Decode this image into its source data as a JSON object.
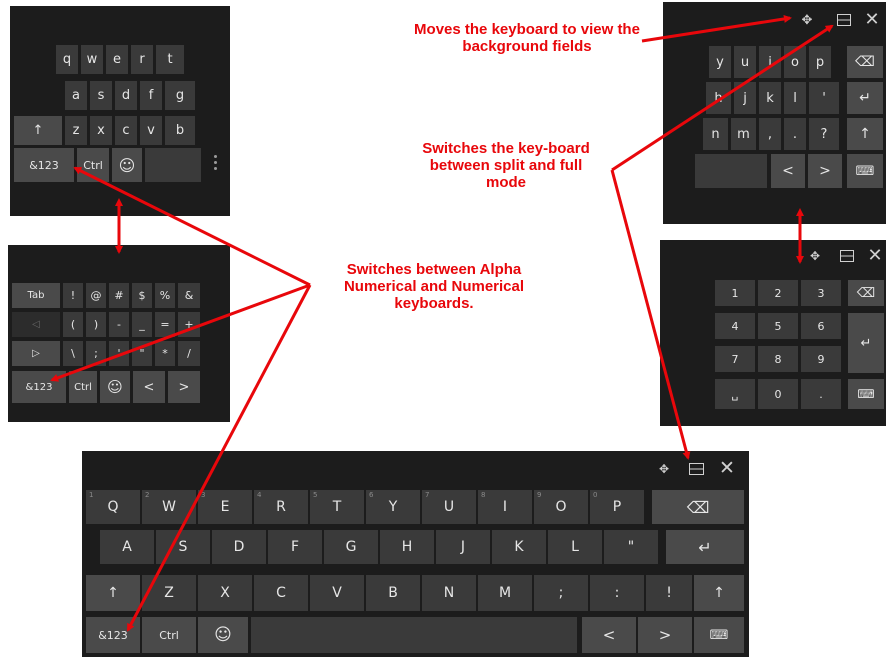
{
  "annotations": {
    "move_keyboard": "Moves the keyboard to view the background fields",
    "split_full": "Switches the key-board between split and full mode",
    "alpha_numeric": "Switches between Alpha Numerical and Numerical keyboards."
  },
  "compact_alpha": {
    "row1": [
      "q",
      "w",
      "e",
      "r",
      "t"
    ],
    "row2": [
      "a",
      "s",
      "d",
      "f",
      "g"
    ],
    "row3": [
      "↑",
      "z",
      "x",
      "c",
      "v",
      "b"
    ],
    "row4": [
      "&123",
      "Ctrl",
      "☺"
    ]
  },
  "compact_symbols": {
    "row1": [
      "Tab",
      "!",
      "@",
      "#",
      "$",
      "%",
      "&"
    ],
    "row2": [
      "<",
      "(",
      ")",
      "-",
      "_",
      "=",
      "+"
    ],
    "row3": [
      ">",
      "\\",
      ";",
      "'",
      "\"",
      "*",
      "/"
    ],
    "row4": [
      "&123",
      "Ctrl",
      "☺",
      "<",
      ">"
    ]
  },
  "split_right": {
    "toolbar": [
      "move",
      "dock",
      "close"
    ],
    "row1": [
      "y",
      "u",
      "i",
      "o",
      "p",
      "⌫"
    ],
    "row2": [
      "h",
      "j",
      "k",
      "l",
      "'",
      "↵"
    ],
    "row3": [
      "n",
      "m",
      ",",
      ".",
      "?",
      "↑"
    ],
    "row4": [
      "<",
      ">",
      "⌨"
    ]
  },
  "numpad": {
    "toolbar": [
      "move",
      "dock",
      "close"
    ],
    "row1": [
      "1",
      "2",
      "3",
      "⌫"
    ],
    "row2": [
      "4",
      "5",
      "6",
      "↵"
    ],
    "row3": [
      "7",
      "8",
      "9"
    ],
    "row4": [
      "␣",
      "0",
      ".",
      " ⌨"
    ]
  },
  "full": {
    "toolbar": [
      "move",
      "dock",
      "close"
    ],
    "row1": [
      {
        "k": "Q",
        "h": "1"
      },
      {
        "k": "W",
        "h": "2"
      },
      {
        "k": "E",
        "h": "3"
      },
      {
        "k": "R",
        "h": "4"
      },
      {
        "k": "T",
        "h": "5"
      },
      {
        "k": "Y",
        "h": "6"
      },
      {
        "k": "U",
        "h": "7"
      },
      {
        "k": "I",
        "h": "8"
      },
      {
        "k": "O",
        "h": "9"
      },
      {
        "k": "P",
        "h": "0"
      }
    ],
    "backspace": "⌫",
    "row2": [
      "A",
      "S",
      "D",
      "F",
      "G",
      "H",
      "J",
      "K",
      "L",
      "\""
    ],
    "enter": "↵",
    "row3": [
      "↑",
      "Z",
      "X",
      "C",
      "V",
      "B",
      "N",
      "M",
      ";",
      ":",
      "!",
      "↑"
    ],
    "row4": [
      "&123",
      "Ctrl",
      "☺",
      "<",
      ">",
      "⌨"
    ]
  },
  "colors": {
    "annotation": "#e8070b",
    "panel": "#1c1c1c",
    "key": "#3a3a3a"
  }
}
